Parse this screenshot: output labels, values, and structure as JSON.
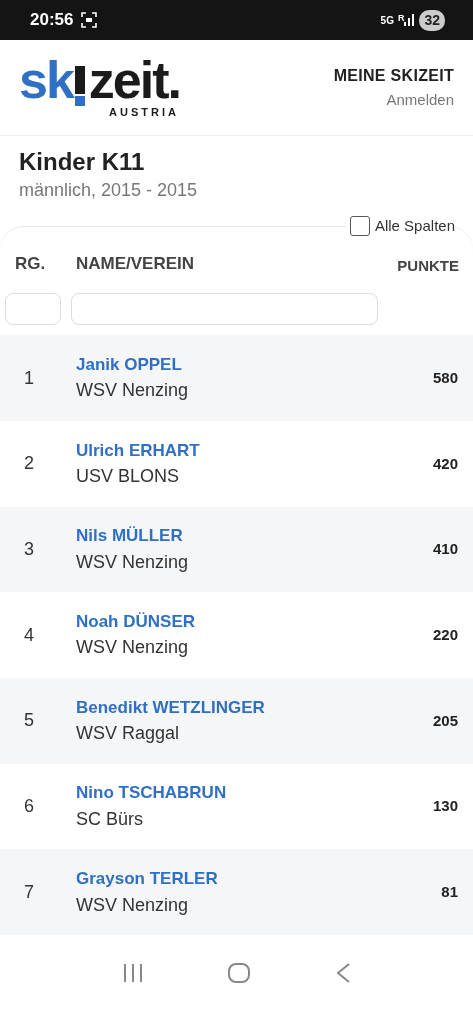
{
  "status_bar": {
    "time": "20:56",
    "network": "5G",
    "roaming": "R",
    "battery": "32"
  },
  "header": {
    "logo": {
      "blue_part": "sk",
      "dark_part": "zeit.",
      "tagline": "AUSTRIA"
    },
    "account_title": "MEINE SKIZEIT",
    "login_link": "Anmelden"
  },
  "category": {
    "title": "Kinder K11",
    "subtitle": "männlich, 2015 - 2015"
  },
  "all_columns": {
    "label": "Alle Spalten",
    "checked": false
  },
  "table": {
    "columns": [
      "RG.",
      "NAME/VEREIN",
      "PUNKTE"
    ],
    "rows": [
      {
        "rank": "1",
        "name": "Janik OPPEL",
        "club": "WSV Nenzing",
        "points": "580"
      },
      {
        "rank": "2",
        "name": "Ulrich ERHART",
        "club": "USV BLONS",
        "points": "420"
      },
      {
        "rank": "3",
        "name": "Nils MÜLLER",
        "club": "WSV Nenzing",
        "points": "410"
      },
      {
        "rank": "4",
        "name": "Noah DÜNSER",
        "club": "WSV Nenzing",
        "points": "220"
      },
      {
        "rank": "5",
        "name": "Benedikt WETZLINGER",
        "club": "WSV Raggal",
        "points": "205"
      },
      {
        "rank": "6",
        "name": "Nino TSCHABRUN",
        "club": "SC Bürs",
        "points": "130"
      },
      {
        "rank": "7",
        "name": "Grayson TERLER",
        "club": "WSV Nenzing",
        "points": "81"
      }
    ]
  }
}
